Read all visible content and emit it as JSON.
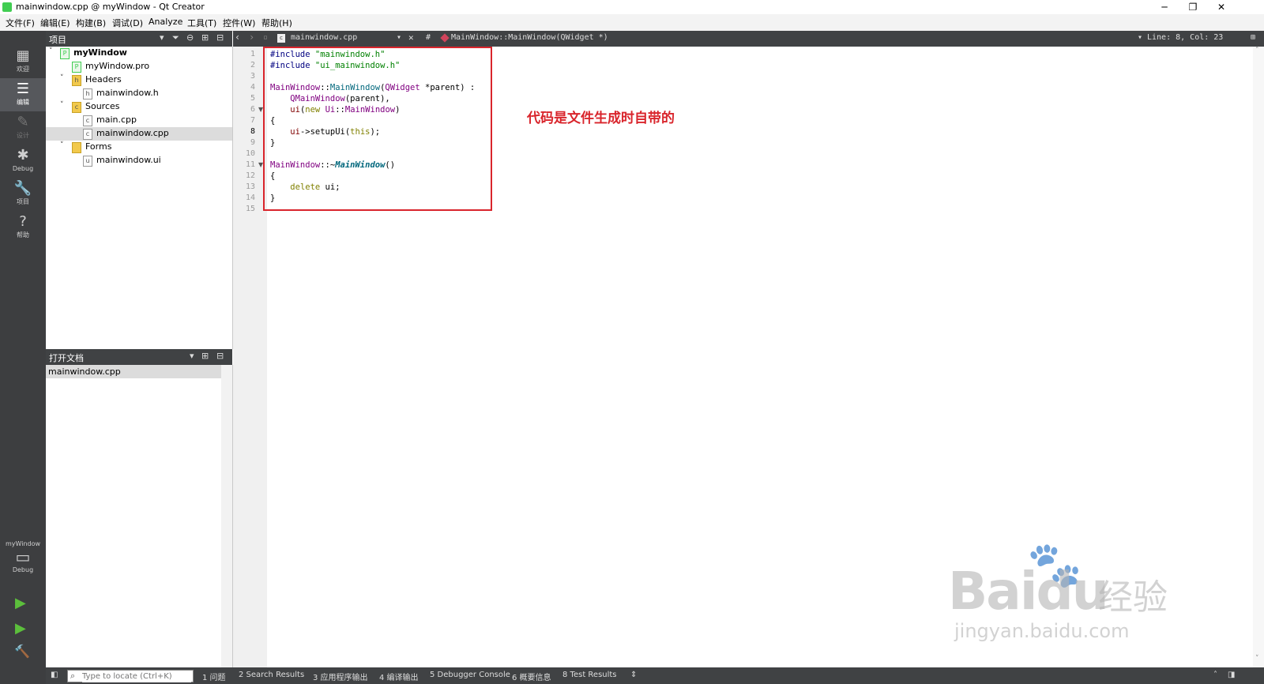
{
  "window": {
    "title": "mainwindow.cpp @ myWindow - Qt Creator",
    "min": "─",
    "max": "❐",
    "close": "✕"
  },
  "menu": [
    "文件(F)",
    "编辑(E)",
    "构建(B)",
    "调试(D)",
    "Analyze",
    "工具(T)",
    "控件(W)",
    "帮助(H)"
  ],
  "modes": [
    {
      "label": "欢迎",
      "icon": "grid-icon",
      "glyph": "▦"
    },
    {
      "label": "编辑",
      "icon": "edit-icon",
      "glyph": "☰"
    },
    {
      "label": "设计",
      "icon": "pencil-icon",
      "glyph": "✎"
    },
    {
      "label": "Debug",
      "icon": "bug-icon",
      "glyph": "✱"
    },
    {
      "label": "项目",
      "icon": "wrench-icon",
      "glyph": "🔧"
    },
    {
      "label": "帮助",
      "icon": "help-icon",
      "glyph": "?"
    }
  ],
  "kit": {
    "project": "myWindow",
    "config": "Debug",
    "monitor": "▭"
  },
  "run": {
    "run": "▶",
    "debug_run": "▶",
    "build": "🔨"
  },
  "project_panel": {
    "title": "项目"
  },
  "tree": [
    {
      "label": "myWindow",
      "bold": true,
      "arrow": "˅",
      "icon": "P"
    },
    {
      "label": "myWindow.pro",
      "icon": "P"
    },
    {
      "label": "Headers",
      "arrow": "˅",
      "icon": "h"
    },
    {
      "label": "mainwindow.h",
      "icon": "h"
    },
    {
      "label": "Sources",
      "arrow": "˅",
      "icon": "c"
    },
    {
      "label": "main.cpp",
      "icon": "c"
    },
    {
      "label": "mainwindow.cpp",
      "icon": "c",
      "selected": true
    },
    {
      "label": "Forms",
      "arrow": "˅",
      "icon": ""
    },
    {
      "label": "mainwindow.ui",
      "icon": "u"
    }
  ],
  "open_docs": {
    "title": "打开文档",
    "items": [
      "mainwindow.cpp"
    ]
  },
  "editor_toolbar": {
    "file": "mainwindow.cpp",
    "symbol_hash": "#",
    "symbol": "MainWindow::MainWindow(QWidget *)",
    "position": "Line: 8, Col: 23"
  },
  "code_lines": [
    "#include \"mainwindow.h\"",
    "#include \"ui_mainwindow.h\"",
    "",
    "MainWindow::MainWindow(QWidget *parent) :",
    "    QMainWindow(parent),",
    "    ui(new Ui::MainWindow)",
    "{",
    "    ui->setupUi(this);",
    "}",
    "",
    "MainWindow::~MainWindow()",
    "{",
    "    delete ui;",
    "}",
    ""
  ],
  "line_numbers": [
    "1",
    "2",
    "3",
    "4",
    "5",
    "6",
    "7",
    "8",
    "9",
    "10",
    "11",
    "12",
    "13",
    "14",
    "15"
  ],
  "annotation": "代码是文件生成时自带的",
  "watermark": {
    "brand": "Bai",
    "brand2": "du",
    "cn": "经验",
    "url": "jingyan.baidu.com"
  },
  "locator": {
    "placeholder": "Type to locate (Ctrl+K)"
  },
  "output_tabs": [
    "1 问题",
    "2 Search Results",
    "3 应用程序输出",
    "4 编译输出",
    "5 Debugger Console",
    "6 概要信息",
    "8 Test Results"
  ]
}
